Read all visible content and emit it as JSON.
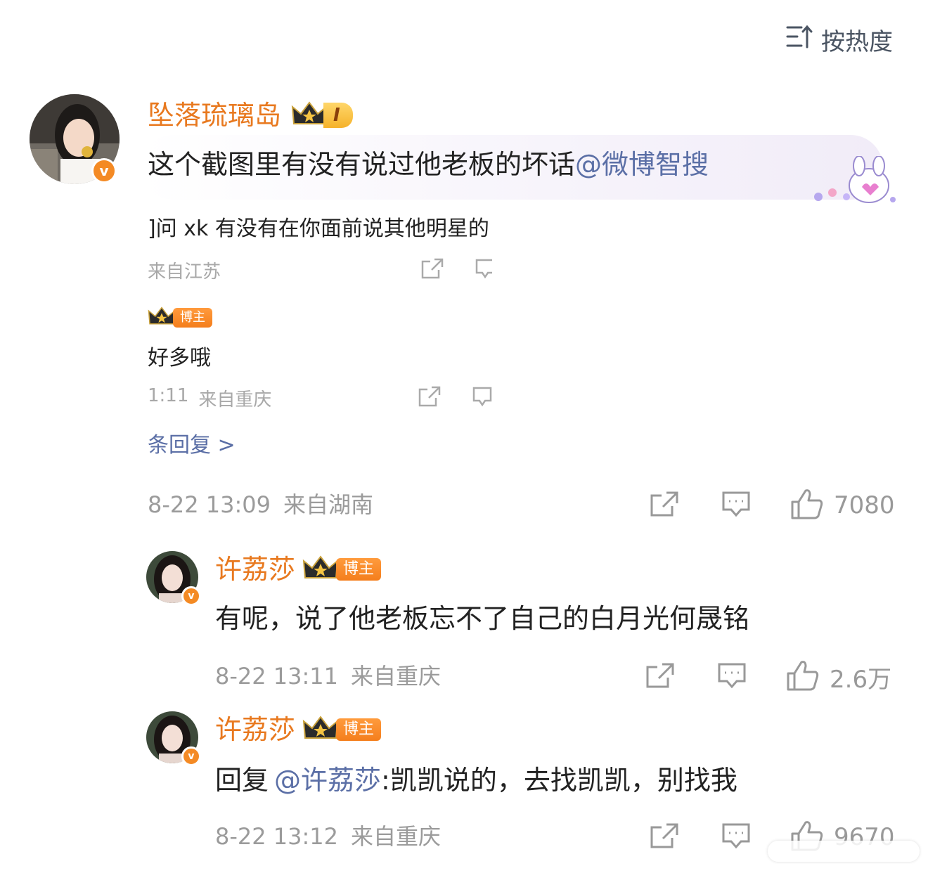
{
  "sort": {
    "label": "按热度",
    "icon": "sort-icon"
  },
  "main_comment": {
    "username": "坠落琉璃岛",
    "level": "I",
    "text": "这个截图里有没有说过他老板的坏话",
    "mention": "@微博智搜",
    "time": "8-22 13:09",
    "location": "来自湖南",
    "likes": "7080"
  },
  "embedded_screenshot": {
    "line1": "]问 xk 有没有在你面前说其他明星的",
    "line1_meta": "来自江苏",
    "reply_tag": "博主",
    "reply_text": "好多哦",
    "reply_meta_time": "1:11",
    "reply_meta_loc": "来自重庆",
    "more_replies": "条回复 >"
  },
  "replies": [
    {
      "username": "许荔莎",
      "tag": "博主",
      "text": "有呢，说了他老板忘不了自己的白月光何晟铭",
      "time": "8-22 13:11",
      "location": "来自重庆",
      "likes": "2.6万"
    },
    {
      "username": "许荔莎",
      "tag": "博主",
      "prefix": "回复",
      "mention": "@许荔莎",
      "text": ":凯凯说的，去找凯凯，别找我",
      "time": "8-22 13:12",
      "location": "来自重庆",
      "likes": "9670"
    }
  ],
  "colors": {
    "accent": "#e8791f",
    "link": "#5b6fa6",
    "muted": "#9b9b9b"
  }
}
